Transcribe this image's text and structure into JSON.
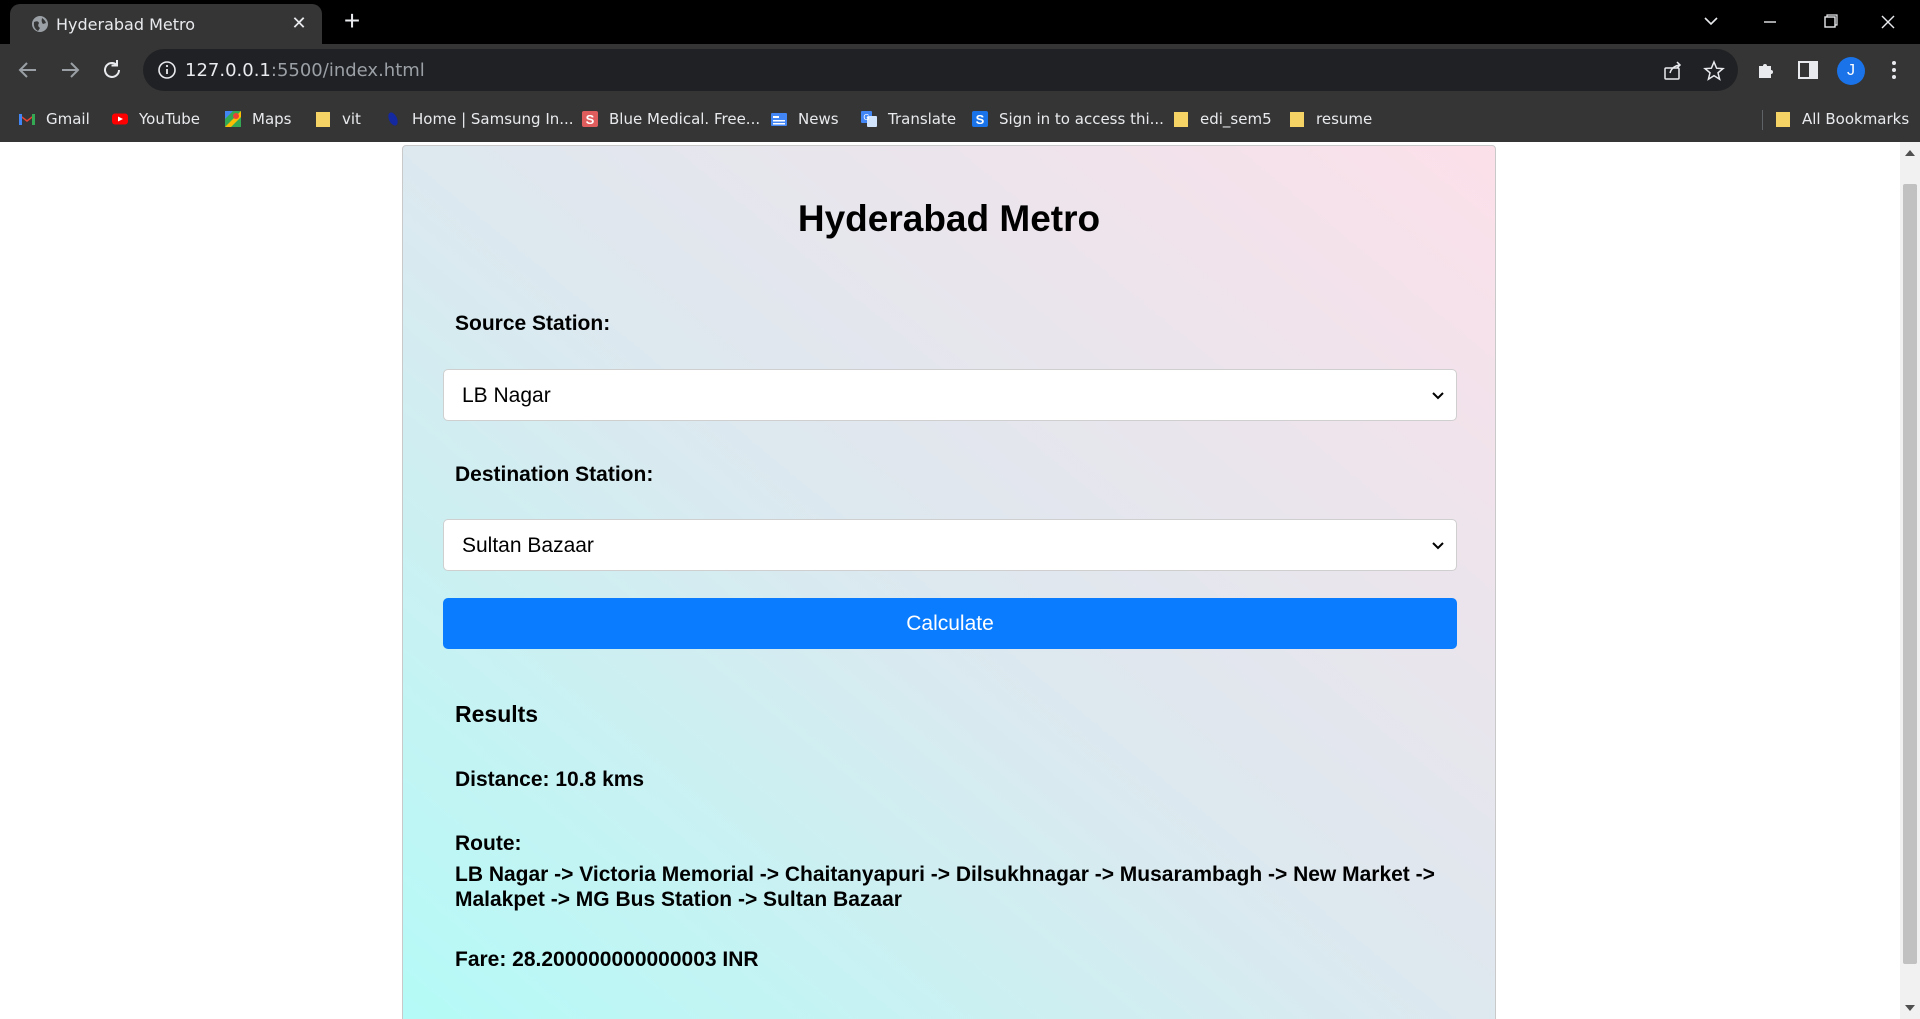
{
  "browser": {
    "tab_title": "Hyderabad Metro",
    "url_host": "127.0.0.1",
    "url_rest": ":5500/index.html",
    "avatar_initial": "J",
    "bookmarks": [
      {
        "label": "Gmail",
        "icon": "gmail-icon"
      },
      {
        "label": "YouTube",
        "icon": "youtube-icon"
      },
      {
        "label": "Maps",
        "icon": "maps-icon"
      },
      {
        "label": "vit",
        "icon": "folder-icon"
      },
      {
        "label": "Home | Samsung In...",
        "icon": "samsung-icon"
      },
      {
        "label": "Blue Medical. Free...",
        "icon": "bluemedical-icon"
      },
      {
        "label": "News",
        "icon": "news-icon"
      },
      {
        "label": "Translate",
        "icon": "translate-icon"
      },
      {
        "label": "Sign in to access thi...",
        "icon": "s-icon"
      },
      {
        "label": "edi_sem5",
        "icon": "folder-icon"
      },
      {
        "label": "resume",
        "icon": "folder-icon"
      }
    ],
    "all_bookmarks_label": "All Bookmarks"
  },
  "page": {
    "title": "Hyderabad Metro",
    "source_label": "Source Station:",
    "source_value": "LB Nagar",
    "destination_label": "Destination Station:",
    "destination_value": "Sultan Bazaar",
    "calculate_label": "Calculate",
    "results_heading": "Results",
    "distance_text": "Distance: 10.8 kms",
    "route_label": "Route:",
    "route_text": "LB Nagar -> Victoria Memorial -> Chaitanyapuri -> Dilsukhnagar -> Musarambagh -> New Market -> Malakpet -> MG Bus Station -> Sultan Bazaar",
    "fare_text": "Fare: 28.200000000000003 INR"
  },
  "colors": {
    "button": "#0a7cff",
    "gradient_bottom_left": "#b3fbf7",
    "gradient_top_right": "#fce0e9"
  }
}
